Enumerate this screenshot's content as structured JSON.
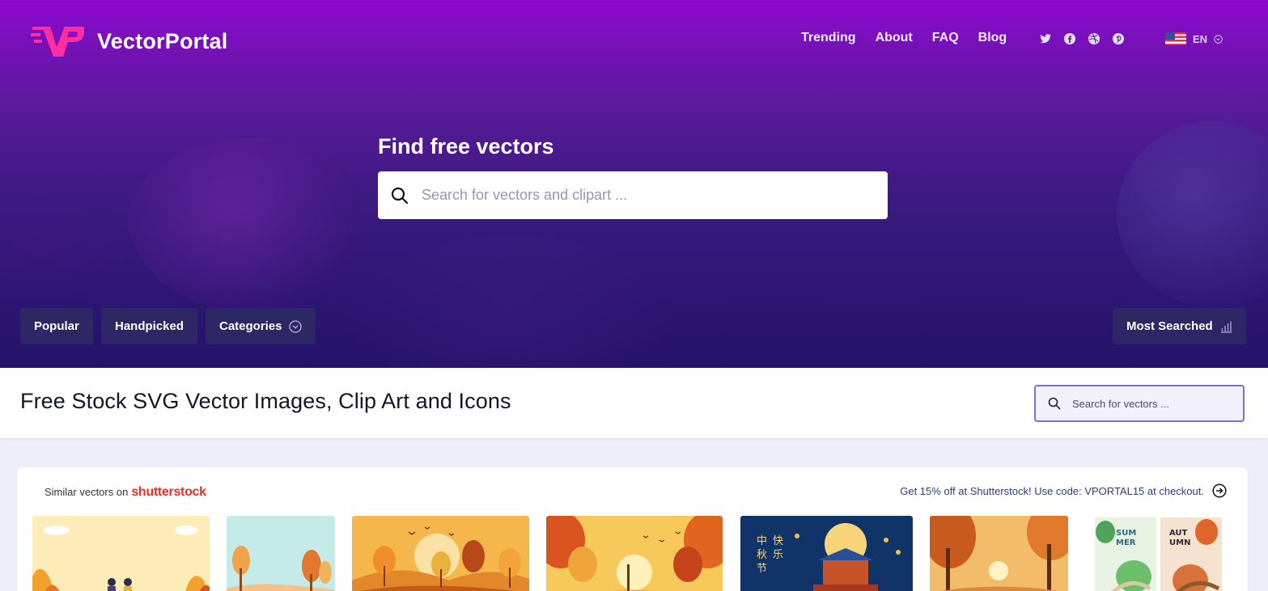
{
  "brand": {
    "name": "VectorPortal",
    "logo_icon": "vp-logo-icon",
    "accent": "#ff2fa0"
  },
  "nav": {
    "items": [
      "Trending",
      "About",
      "FAQ",
      "Blog"
    ]
  },
  "social": [
    "twitter-icon",
    "facebook-icon",
    "dribbble-icon",
    "pinterest-icon"
  ],
  "language": {
    "code": "EN",
    "flag": "us-flag-icon"
  },
  "hero": {
    "title": "Find free vectors",
    "search_placeholder": "Search for vectors and clipart ..."
  },
  "filters": {
    "popular": "Popular",
    "handpicked": "Handpicked",
    "categories": "Categories",
    "most_searched": "Most Searched"
  },
  "page": {
    "title": "Free Stock SVG Vector Images, Clip Art and Icons",
    "search_placeholder": "Search for vectors ..."
  },
  "shutterstock": {
    "label": "Similar vectors on",
    "brand": "shutterstock",
    "promo": "Get 15% off at Shutterstock! Use code: VPORTAL15 at checkout."
  },
  "thumbnails": [
    {
      "name": "autumn-couple-illustration",
      "colors": [
        "#fde8b6",
        "#f5a623"
      ]
    },
    {
      "name": "autumn-trees-landscape",
      "colors": [
        "#bfe6e3",
        "#f0a04b"
      ]
    },
    {
      "name": "autumn-sunset-hills",
      "colors": [
        "#f7b54b",
        "#d86a1c"
      ]
    },
    {
      "name": "autumn-forest-birds",
      "colors": [
        "#f4c04c",
        "#c8471c"
      ]
    },
    {
      "name": "mid-autumn-festival",
      "colors": [
        "#163a6e",
        "#0a1f44"
      ]
    },
    {
      "name": "autumn-forest-path",
      "colors": [
        "#f3b35a",
        "#b35a22"
      ]
    },
    {
      "name": "summer-autumn-seasons",
      "colors": [
        "#e8f1e4",
        "#d9713a"
      ]
    }
  ]
}
